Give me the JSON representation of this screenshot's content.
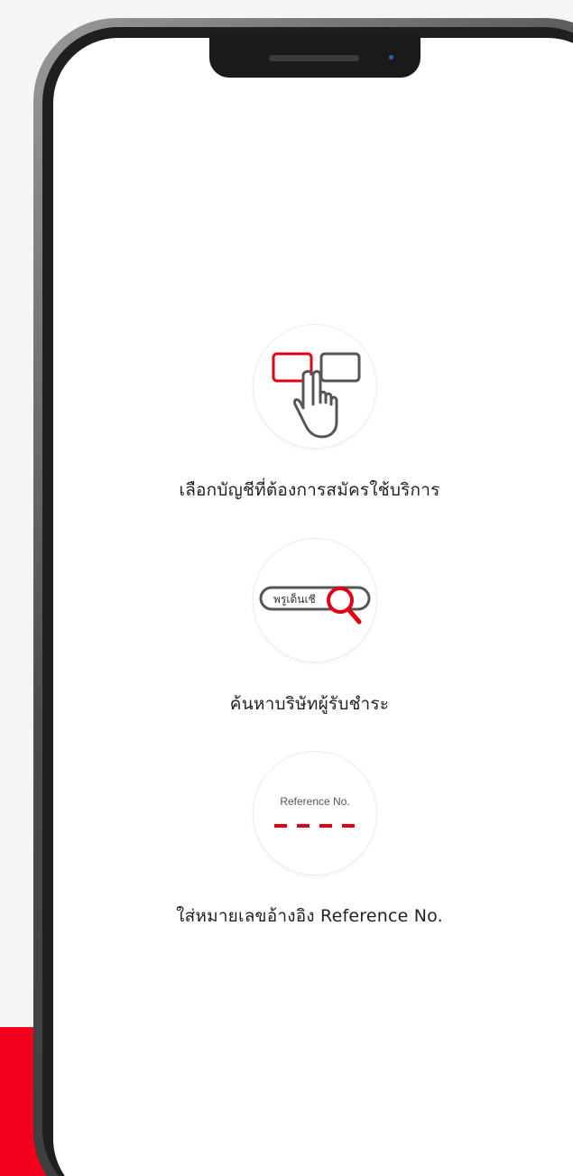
{
  "colors": {
    "accent_red": "#e00016",
    "band_red": "#f2001c",
    "background": "#f6f5f3"
  },
  "steps": [
    {
      "icon": "tap-select-account-icon",
      "label": "เลือกบัญชีที่ต้องการสมัครใช้บริการ"
    },
    {
      "icon": "search-company-icon",
      "icon_text": "พรูเด็นเชี",
      "label": "ค้นหาบริษัทผู้รับชำระ"
    },
    {
      "icon": "reference-number-icon",
      "icon_text": "Reference No.",
      "label": "ใส่หมายเลขอ้างอิง Reference No."
    }
  ]
}
